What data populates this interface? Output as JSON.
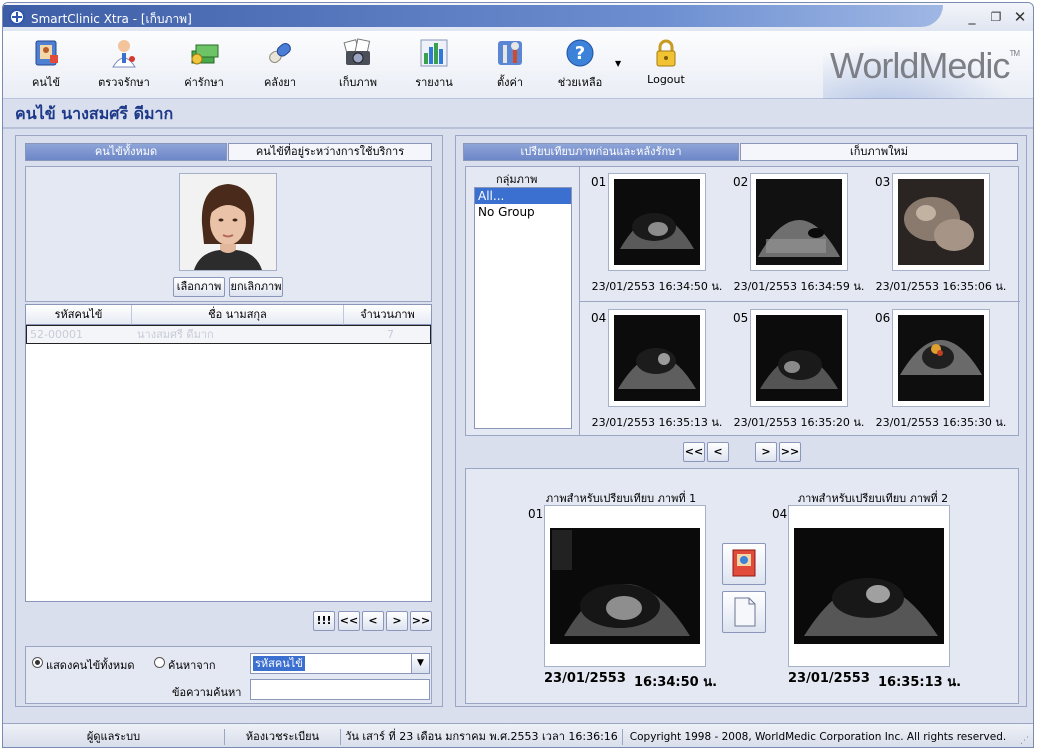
{
  "window": {
    "title": "SmartClinic Xtra - [เก็บภาพ]"
  },
  "toolbar": {
    "items": [
      {
        "label": "คนไข้",
        "icon": "patient-file-icon"
      },
      {
        "label": "ตรวจรักษา",
        "icon": "doctor-icon"
      },
      {
        "label": "ค่ารักษา",
        "icon": "money-icon"
      },
      {
        "label": "คลังยา",
        "icon": "capsule-icon"
      },
      {
        "label": "เก็บภาพ",
        "icon": "camera-icon"
      },
      {
        "label": "รายงาน",
        "icon": "bar-chart-icon"
      },
      {
        "label": "ตั้งค่า",
        "icon": "settings-tools-icon"
      },
      {
        "label": "ช่วยเหลือ",
        "icon": "help-icon"
      },
      {
        "label": "Logout",
        "icon": "lock-icon"
      }
    ],
    "logo": "WorldMedic",
    "logo_tm": "TM"
  },
  "heading": "คนไข้  นางสมศรี ดีมาก",
  "left": {
    "tabs": [
      "คนไข้ทั้งหมด",
      "คนไข้ที่อยู่ระหว่างการใช้บริการ"
    ],
    "select_photo": "เลือกภาพ",
    "cancel_photo": "ยกเลิกภาพ",
    "grid": {
      "headers": [
        "รหัสคนไข้",
        "ชื่อ นามสกุล",
        "จำนวนภาพ"
      ],
      "rows": [
        {
          "id": "52-00001",
          "name": "นางสมศรี ดีมาก",
          "count": "7"
        }
      ]
    },
    "pager": [
      "!!!",
      "<<",
      "<",
      ">",
      ">>"
    ],
    "filter": {
      "radio_all": "แสดงคนไข้ทั้งหมด",
      "radio_search": "ค้นหาจาก",
      "search_by_value": "รหัสคนไข้",
      "search_text_label": "ข้อความค้นหา",
      "search_text_value": ""
    }
  },
  "right": {
    "tabs": [
      "เปรียบเทียบภาพก่อนและหลังรักษา",
      "เก็บภาพใหม่"
    ],
    "group_label": "กลุ่มภาพ",
    "groups": [
      "All...",
      "No Group"
    ],
    "thumbnails": [
      {
        "num": "01",
        "caption": "23/01/2553  16:34:50 น."
      },
      {
        "num": "02",
        "caption": "23/01/2553  16:34:59 น."
      },
      {
        "num": "03",
        "caption": "23/01/2553  16:35:06 น."
      },
      {
        "num": "04",
        "caption": "23/01/2553  16:35:13 น."
      },
      {
        "num": "05",
        "caption": "23/01/2553  16:35:20 น."
      },
      {
        "num": "06",
        "caption": "23/01/2553  16:35:30 น."
      }
    ],
    "pager": [
      "<<",
      "<",
      ">",
      ">>"
    ],
    "compare": [
      {
        "title": "ภาพสำหรับเปรียบเทียบ ภาพที่ 1",
        "num": "01",
        "date": "23/01/2553",
        "time": "16:34:50 น."
      },
      {
        "title": "ภาพสำหรับเปรียบเทียบ ภาพที่ 2",
        "num": "04",
        "date": "23/01/2553",
        "time": "16:35:13 น."
      }
    ]
  },
  "status": {
    "user": "ผู้ดูแลระบบ",
    "room": "ห้องเวชระเบียน",
    "datetime": "วัน เสาร์ ที่ 23 เดือน มกราคม พ.ศ.2553 เวลา 16:36:16 น.",
    "copyright": "Copyright 1998 - 2008, WorldMedic Corporation Inc. All rights reserved."
  }
}
